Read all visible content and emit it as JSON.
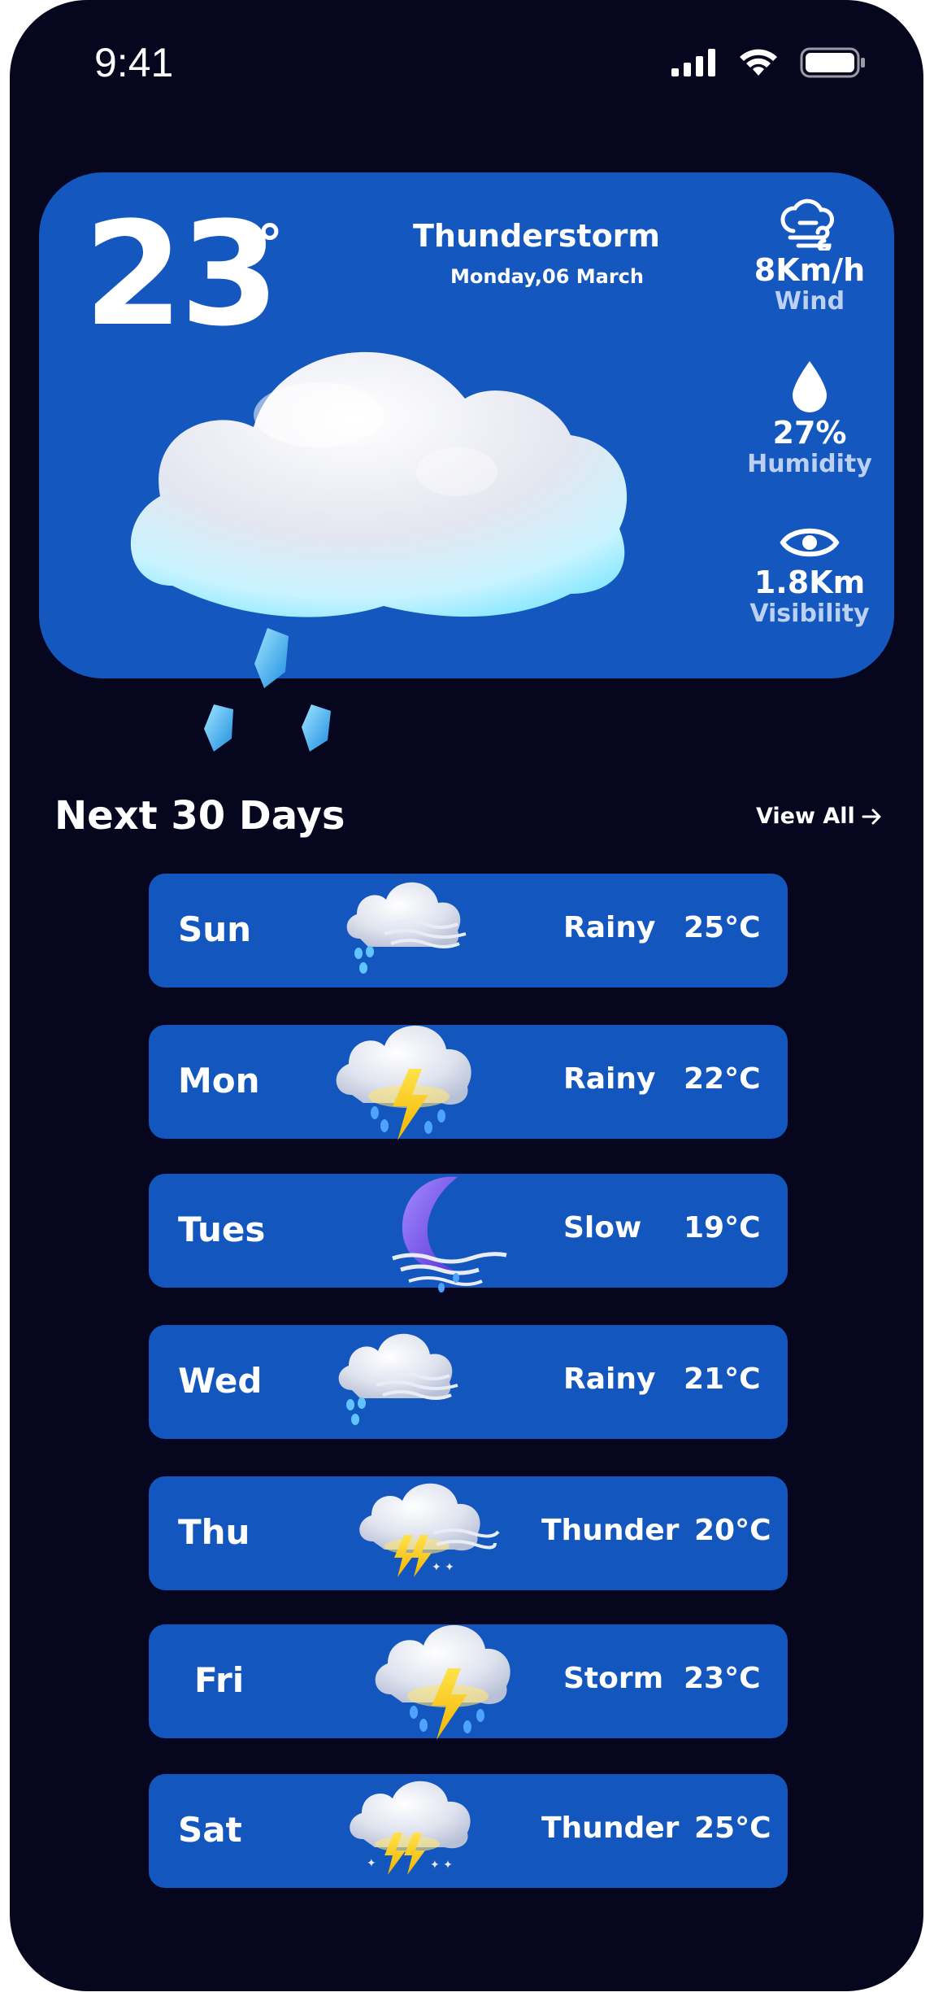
{
  "status_bar": {
    "time": "9:41"
  },
  "current": {
    "temperature": "23",
    "degree_symbol": "°",
    "condition": "Thunderstorm",
    "date": "Monday,06 March",
    "stats": [
      {
        "icon": "wind-icon",
        "value": "8Km/h",
        "label": "Wind"
      },
      {
        "icon": "droplet-icon",
        "value": "27%",
        "label": "Humidity"
      },
      {
        "icon": "eye-icon",
        "value": "1.8Km",
        "label": "Visibility"
      }
    ]
  },
  "forecast": {
    "title": "Next 30 Days",
    "view_all": "View All",
    "days": [
      {
        "day": "Sun",
        "condition": "Rainy",
        "temp": "25°C",
        "icon": "cloud-rain-wind-icon"
      },
      {
        "day": "Mon",
        "condition": "Rainy",
        "temp": "22°C",
        "icon": "cloud-lightning-rain-icon"
      },
      {
        "day": "Tues",
        "condition": "Slow",
        "temp": "19°C",
        "icon": "moon-wind-icon"
      },
      {
        "day": "Wed",
        "condition": "Rainy",
        "temp": "21°C",
        "icon": "cloud-rain-wind-icon"
      },
      {
        "day": "Thu",
        "condition": "Thunder",
        "temp": "20°C",
        "icon": "cloud-thunder-wind-icon"
      },
      {
        "day": "Fri",
        "condition": "Storm",
        "temp": "23°C",
        "icon": "cloud-lightning-rain-icon"
      },
      {
        "day": "Sat",
        "condition": "Thunder",
        "temp": "25°C",
        "icon": "cloud-thunder-icon"
      }
    ]
  },
  "colors": {
    "background": "#07061f",
    "card": "#1357bf",
    "text": "#ffffff",
    "muted": "#bcd1f2"
  }
}
